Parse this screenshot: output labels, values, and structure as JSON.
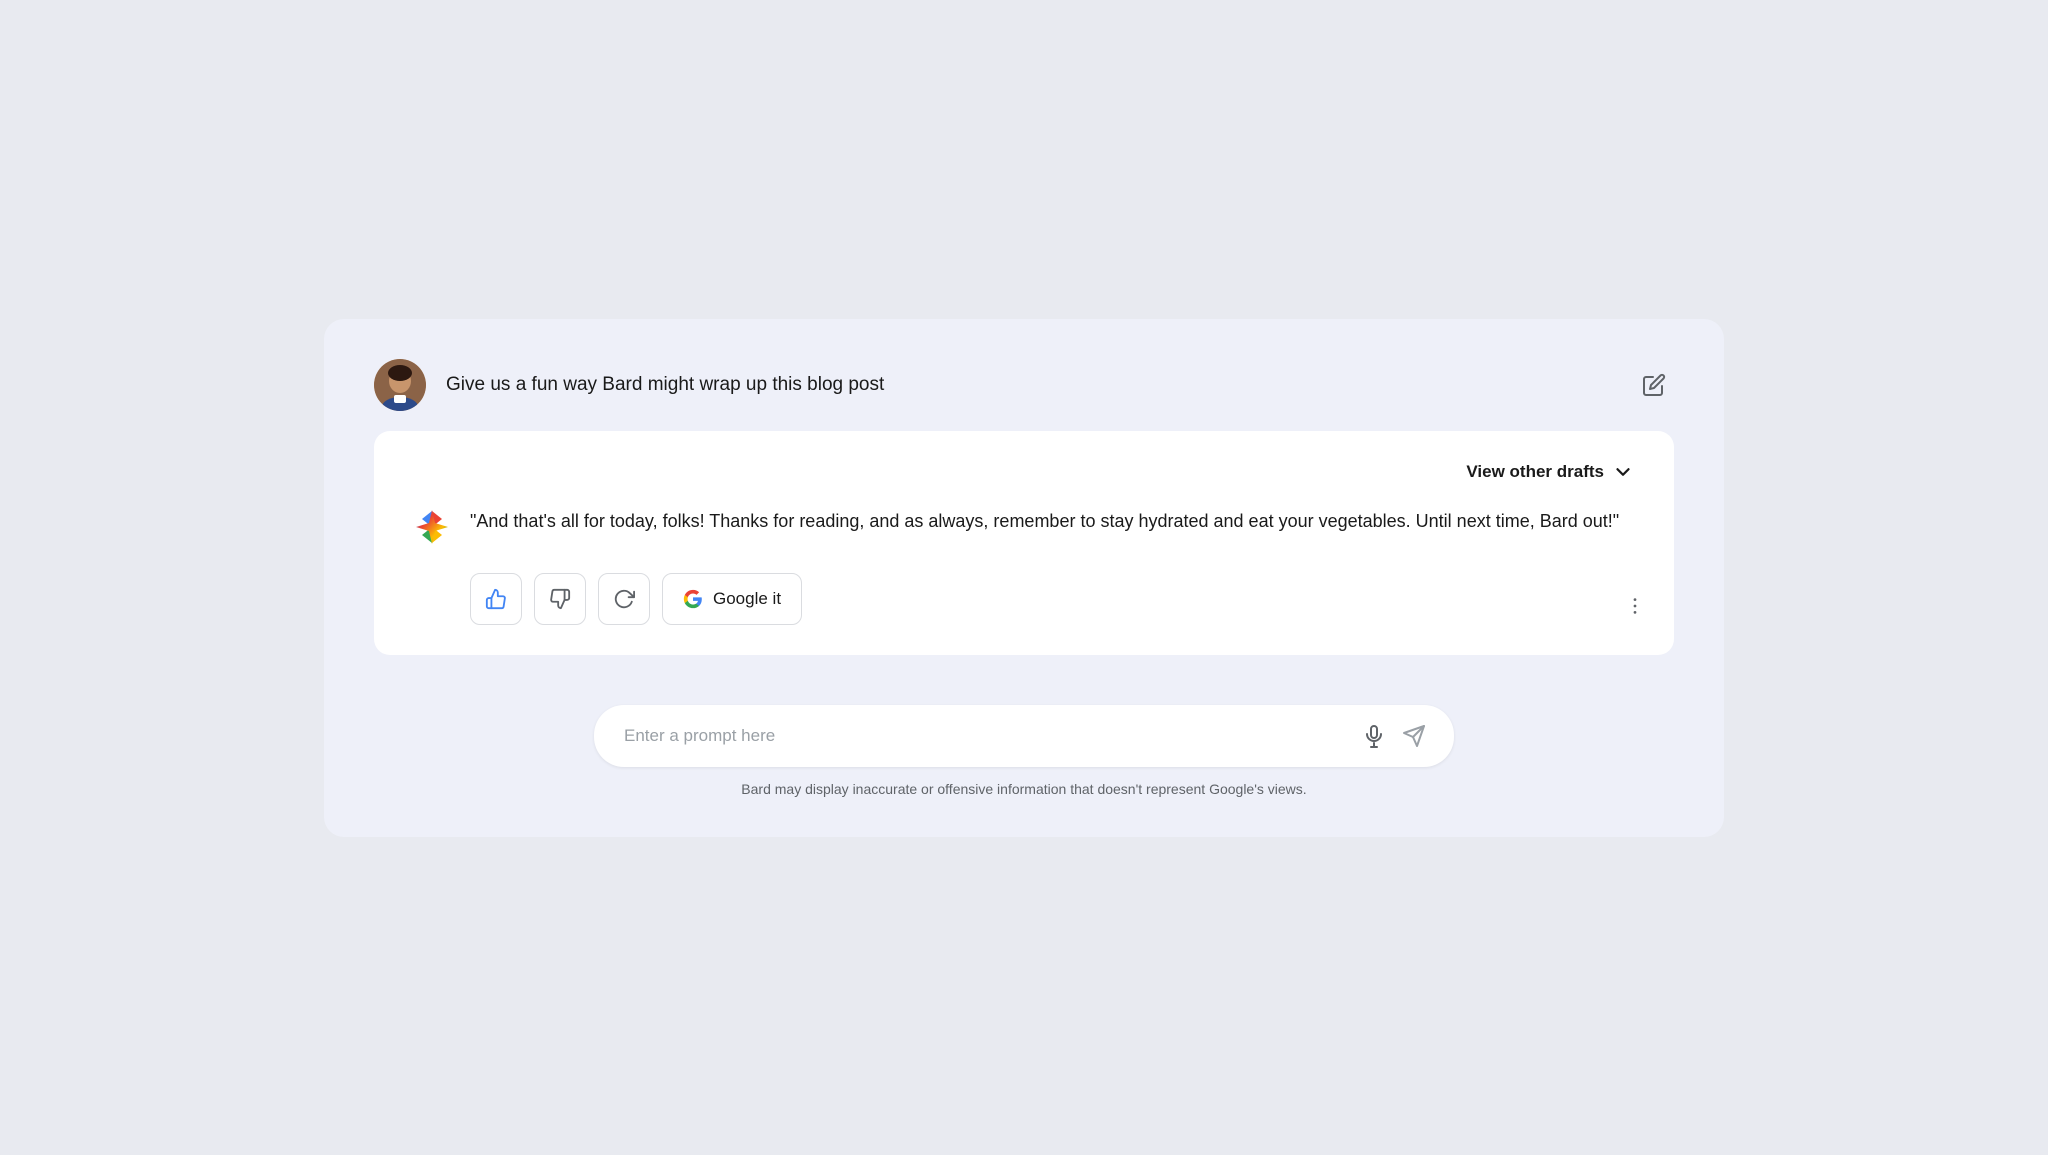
{
  "page": {
    "background": "#e8eaf0"
  },
  "user_prompt": {
    "text": "Give us a fun way Bard might wrap up this blog post",
    "edit_icon": "✏"
  },
  "response_card": {
    "view_drafts_label": "View other drafts",
    "chevron": "∨",
    "response_text": "\"And that's all for today, folks! Thanks for reading, and as always, remember to stay hydrated and eat your vegetables. Until next time, Bard out!\"",
    "buttons": {
      "thumbs_up_label": "👍",
      "thumbs_down_label": "👎",
      "refresh_label": "↺",
      "google_it_label": "Google it"
    },
    "more_options_icon": "⋮"
  },
  "input_area": {
    "placeholder": "Enter a prompt here",
    "mic_icon": "🎤",
    "send_icon": "▷",
    "disclaimer": "Bard may display inaccurate or offensive information that doesn't represent Google's views."
  }
}
